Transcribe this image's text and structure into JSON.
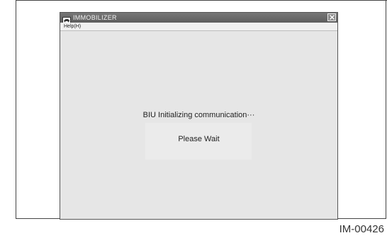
{
  "window": {
    "title": "IMMOBILIZER",
    "menu": {
      "help_label": "Help(H)"
    },
    "status_message": "BIU Initializing communication···",
    "wait_message": "Please Wait"
  },
  "figure_id": "IM-00426",
  "icons": {
    "app": "car-icon",
    "close": "close-icon"
  },
  "colors": {
    "titlebar": "#666666",
    "window_bg": "#e6e6e6",
    "text": "#222222"
  }
}
